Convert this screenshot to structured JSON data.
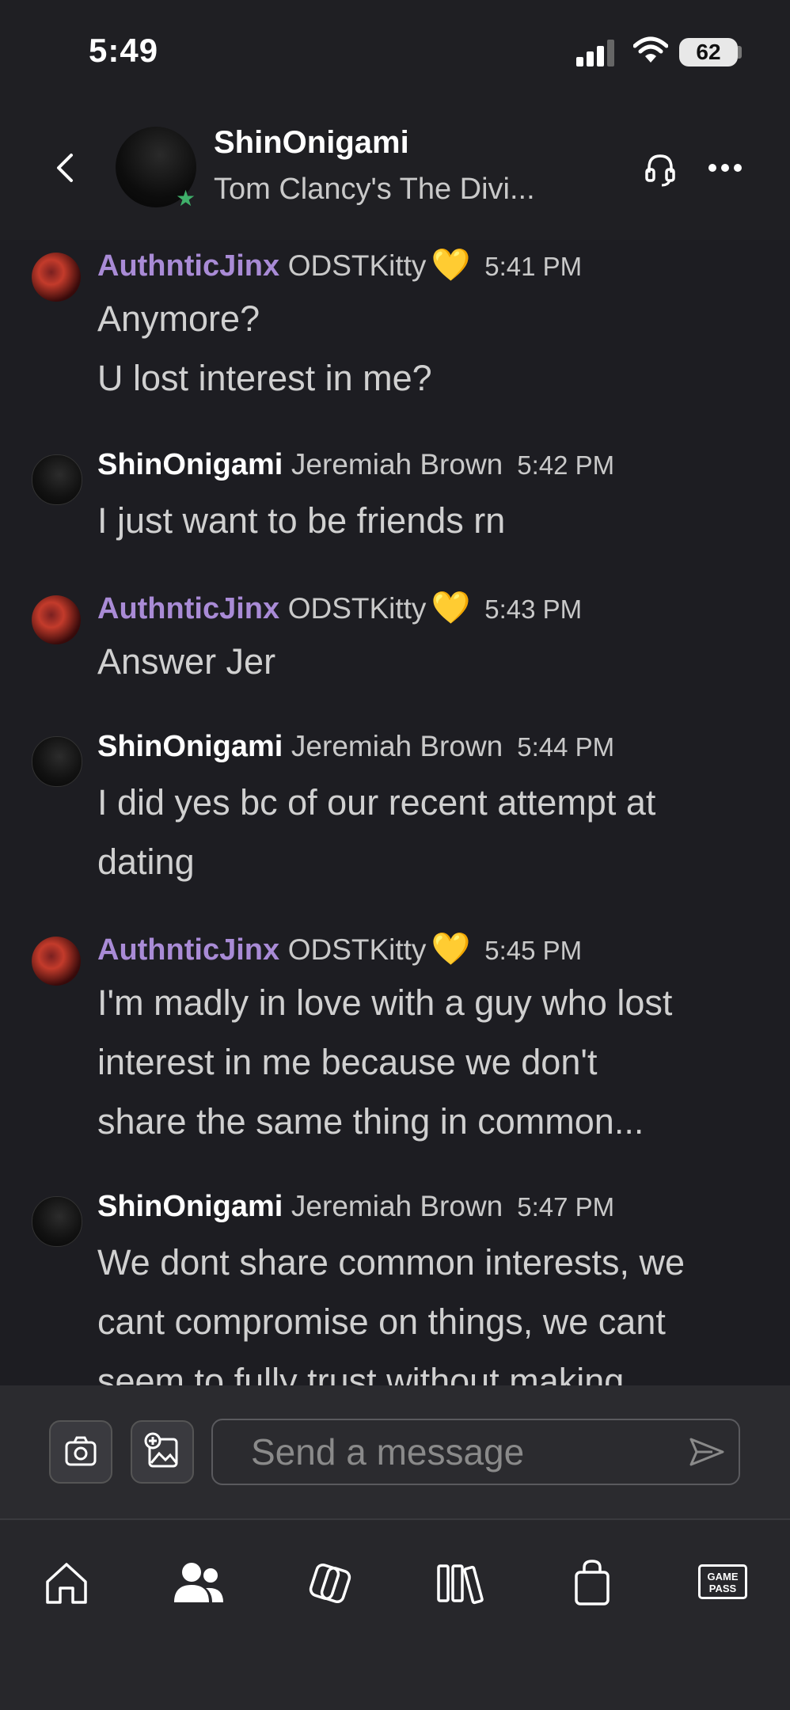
{
  "status_bar": {
    "time": "5:49",
    "battery": "62"
  },
  "header": {
    "title": "ShinOnigami",
    "subtitle": "Tom Clancy's The Divi..."
  },
  "messages": [
    {
      "sender": "AuthnticJinx",
      "gamertag": "ODSTKitty",
      "heart": "💛",
      "time": "5:41 PM",
      "lines": [
        "Anymore?",
        "U lost interest in me?"
      ]
    },
    {
      "sender": "ShinOnigami",
      "gamertag": "Jeremiah Brown",
      "time": "5:42 PM",
      "lines": [
        "I just want to be friends rn"
      ]
    },
    {
      "sender": "AuthnticJinx",
      "gamertag": "ODSTKitty",
      "heart": "💛",
      "time": "5:43 PM",
      "lines": [
        "Answer Jer"
      ]
    },
    {
      "sender": "ShinOnigami",
      "gamertag": "Jeremiah Brown",
      "time": "5:44 PM",
      "lines": [
        "I did yes bc of our recent attempt at",
        "dating"
      ]
    },
    {
      "sender": "AuthnticJinx",
      "gamertag": "ODSTKitty",
      "heart": "💛",
      "time": "5:45 PM",
      "lines": [
        "I'm madly in love with a guy who lost",
        "interest in me because we don't",
        "share the same thing in common..."
      ]
    },
    {
      "sender": "ShinOnigami",
      "gamertag": "Jeremiah Brown",
      "time": "5:47 PM",
      "lines": [
        "We dont share common interests, we",
        "cant compromise on things, we cant",
        "seem to fully trust without making"
      ]
    }
  ],
  "composer": {
    "placeholder": "Send a message"
  },
  "nav": {
    "gamepass_line1": "GAME",
    "gamepass_line2": "PASS"
  },
  "colors": {
    "jinx_name": "#a98bd6",
    "online": "#3fb06a",
    "heart": "#f5c842"
  }
}
